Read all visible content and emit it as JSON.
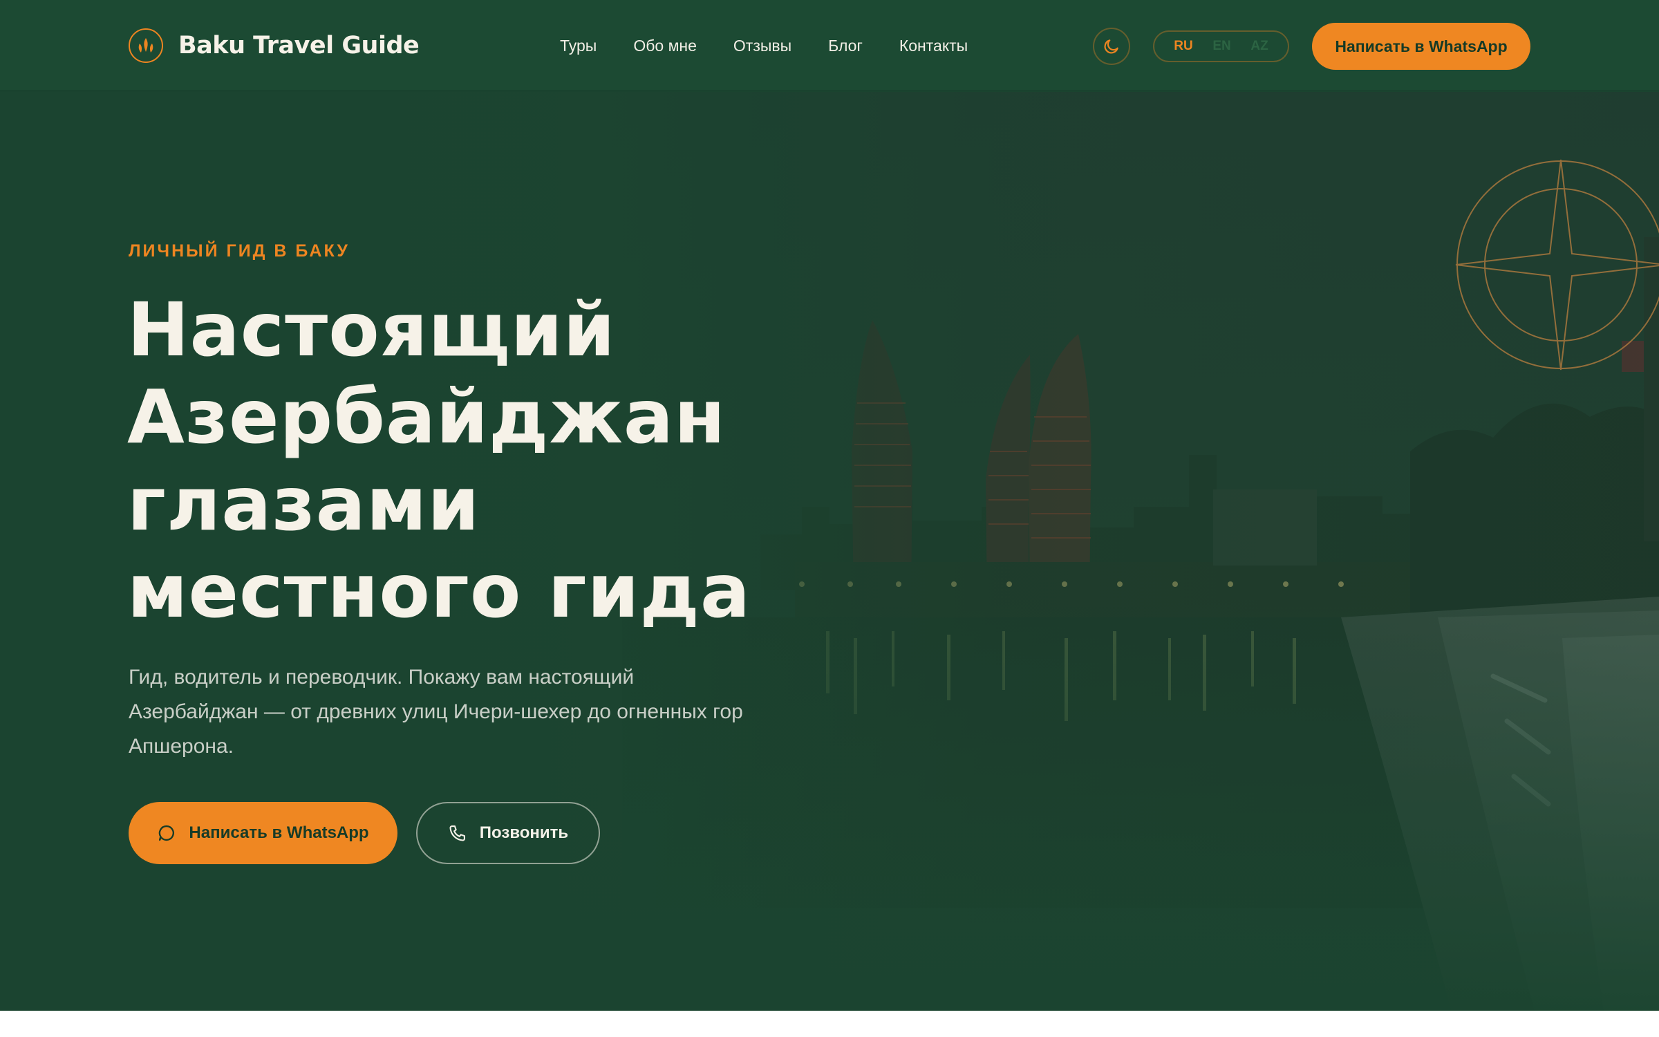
{
  "colors": {
    "accent": "#ef8722",
    "header_bg": "#1c4a33",
    "hero_bg": "#1c4631",
    "text_light": "#f6f2e8",
    "text_muted": "#c9cfc7"
  },
  "header": {
    "logo_icon": "flame-leaf-icon",
    "brand": "Baku Travel Guide",
    "nav": [
      "Туры",
      "Обо мне",
      "Отзывы",
      "Блог",
      "Контакты"
    ],
    "theme_icon": "moon-icon",
    "languages": [
      {
        "code": "RU",
        "active": true
      },
      {
        "code": "EN",
        "active": false
      },
      {
        "code": "AZ",
        "active": false
      }
    ],
    "cta_label": "Написать в WhatsApp"
  },
  "hero": {
    "eyebrow": "ЛИЧНЫЙ ГИД В БАКУ",
    "title_lines": [
      "Настоящий",
      "Азербайджан",
      "глазами",
      "местного гида"
    ],
    "subtitle": "Гид, водитель и переводчик. Покажу вам настоящий Азербайджан — от древних улиц Ичери-шехер до огненных гор Апшерона.",
    "primary_button": {
      "label": "Написать в WhatsApp",
      "icon": "chat-bubble-icon"
    },
    "secondary_button": {
      "label": "Позвонить",
      "icon": "phone-icon"
    },
    "decor_icon": "compass-star-icon"
  }
}
